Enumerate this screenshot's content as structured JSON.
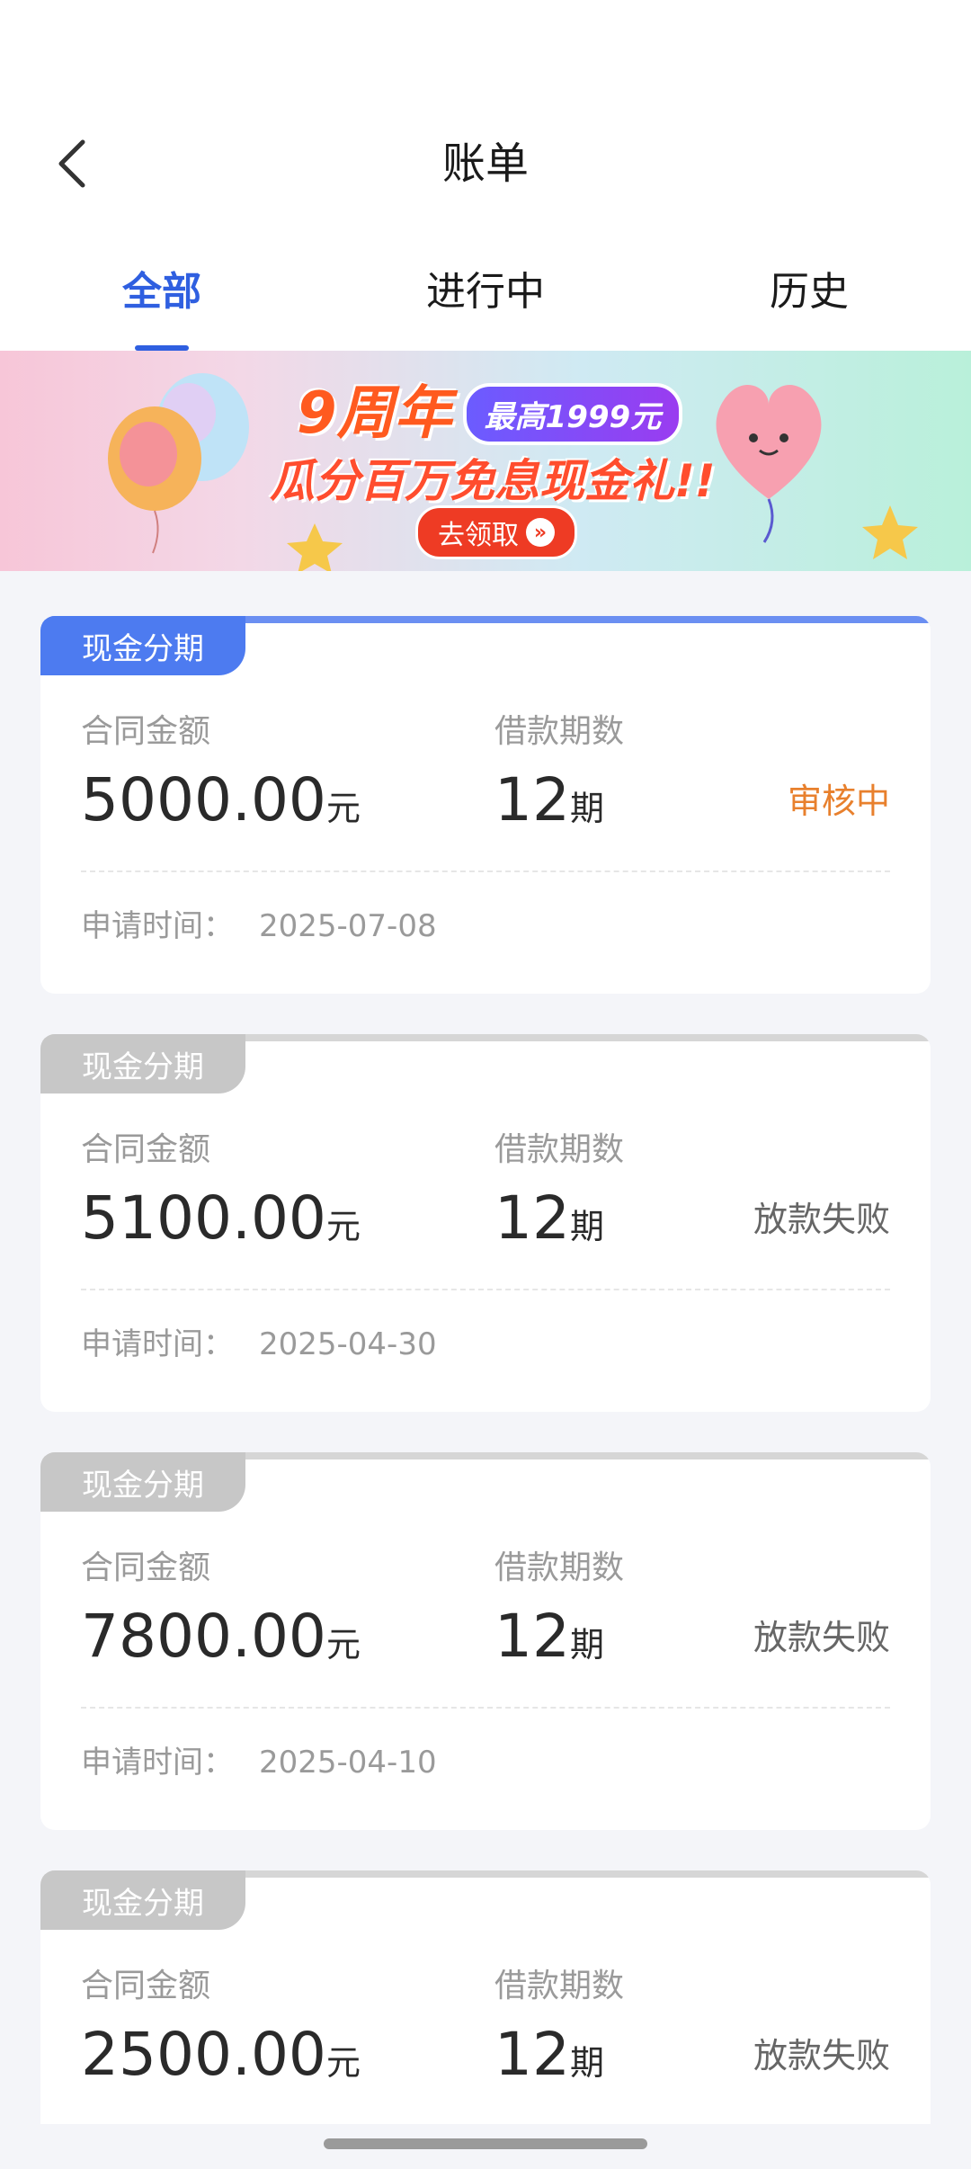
{
  "header": {
    "title": "账单"
  },
  "tabs": [
    {
      "label": "全部",
      "active": true
    },
    {
      "label": "进行中",
      "active": false
    },
    {
      "label": "历史",
      "active": false
    }
  ],
  "banner": {
    "anniversary": "9周年",
    "badge": "最高1999元",
    "subtitle": "瓜分百万免息现金礼!!",
    "cta": "去领取"
  },
  "labels": {
    "amount": "合同金额",
    "term": "借款期数",
    "apply_time": "申请时间："
  },
  "units": {
    "currency": "元",
    "period": "期"
  },
  "bills": [
    {
      "tag": "现金分期",
      "amount": "5000.00",
      "term": "12",
      "status": "审核中",
      "date": "2025-07-08"
    },
    {
      "tag": "现金分期",
      "amount": "5100.00",
      "term": "12",
      "status": "放款失败",
      "date": "2025-04-30"
    },
    {
      "tag": "现金分期",
      "amount": "7800.00",
      "term": "12",
      "status": "放款失败",
      "date": "2025-04-10"
    },
    {
      "tag": "现金分期",
      "amount": "2500.00",
      "term": "12",
      "status": "放款失败",
      "date": ""
    }
  ],
  "colors": {
    "accent": "#2f5fe0",
    "pending": "#e8802d",
    "tag_active": "#4d7bf0",
    "tag_inactive": "#c7c7c7"
  }
}
